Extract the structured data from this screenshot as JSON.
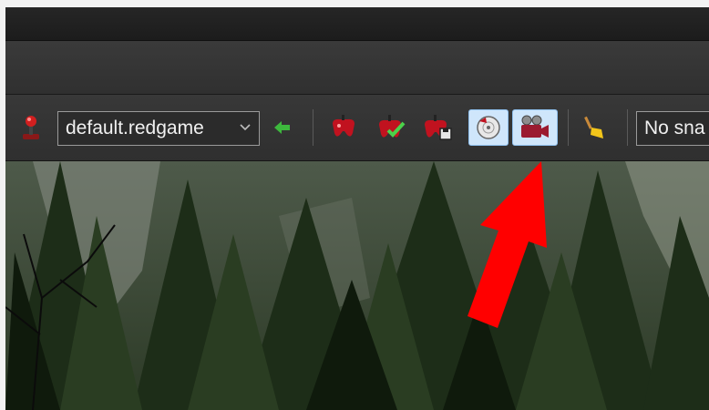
{
  "toolbar": {
    "profile_select": {
      "value": "default.redgame",
      "chevron_icon": "chevron-down-icon"
    },
    "snapshot_select": {
      "value": "No sna"
    },
    "icons": {
      "joystick": "joystick-icon",
      "back": "green-back-arrow-icon",
      "game_pad": "red-gamepad-icon",
      "game_check": "red-gamepad-check-icon",
      "game_save": "red-gamepad-save-icon",
      "disc": "disc-icon",
      "camera": "video-camera-icon",
      "broom": "broom-icon"
    },
    "active_buttons": [
      "disc",
      "camera"
    ]
  },
  "annotation": {
    "arrow_color": "#ff0000"
  },
  "colors": {
    "toolbar_bg": "#333333",
    "active_bg": "#cfe6fb",
    "active_border": "#8fc0ee",
    "back_arrow": "#3db83d",
    "gamepad_red": "#c1121f"
  }
}
